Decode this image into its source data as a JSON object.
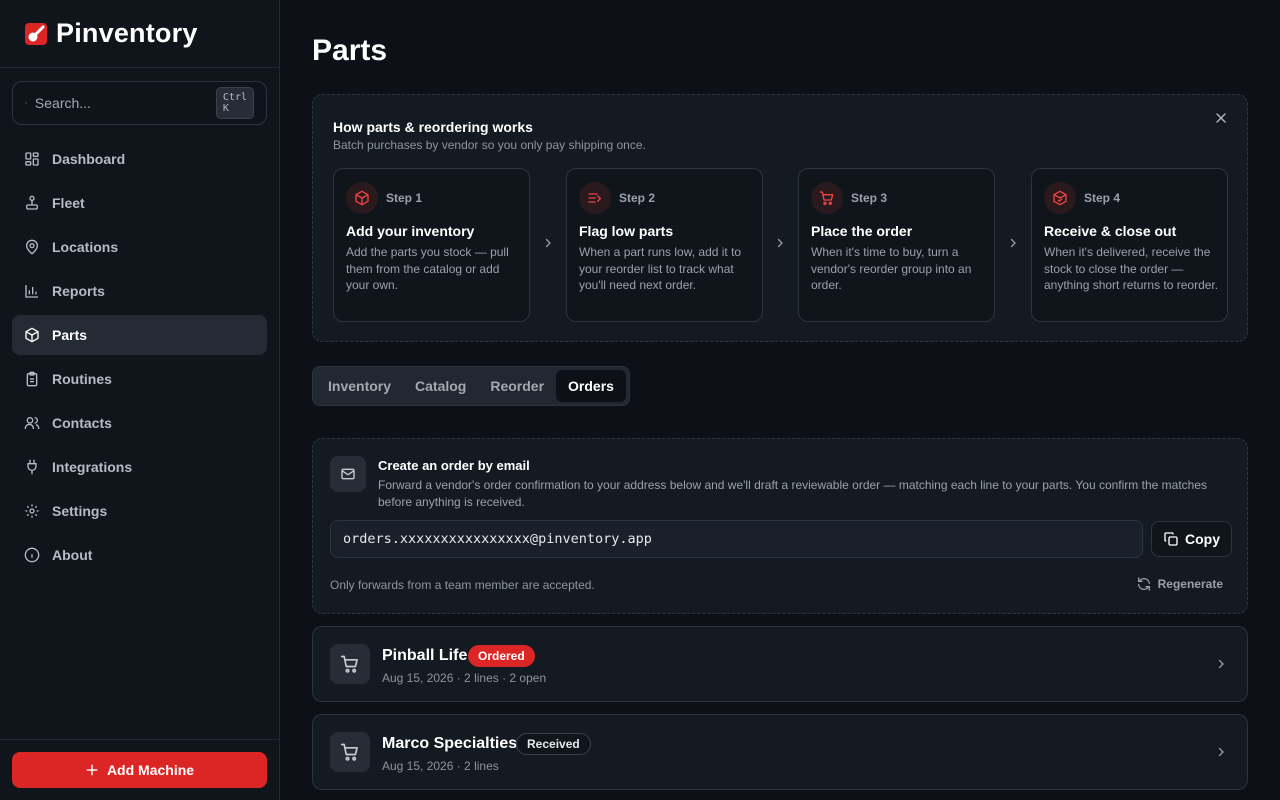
{
  "app": {
    "name": "Pinventory"
  },
  "search": {
    "placeholder": "Search...",
    "shortcut": "Ctrl K"
  },
  "sidebar": {
    "items": [
      {
        "label": "Dashboard",
        "icon": "dashboard-icon"
      },
      {
        "label": "Fleet",
        "icon": "joystick-icon"
      },
      {
        "label": "Locations",
        "icon": "map-pin-icon"
      },
      {
        "label": "Reports",
        "icon": "bar-chart-icon"
      },
      {
        "label": "Parts",
        "icon": "package-icon",
        "active": true
      },
      {
        "label": "Routines",
        "icon": "clipboard-icon"
      },
      {
        "label": "Contacts",
        "icon": "users-icon"
      },
      {
        "label": "Integrations",
        "icon": "plug-icon"
      },
      {
        "label": "Settings",
        "icon": "gear-icon"
      },
      {
        "label": "About",
        "icon": "info-icon"
      }
    ],
    "add_button": "Add Machine"
  },
  "page": {
    "title": "Parts"
  },
  "howto": {
    "title": "How parts & reordering works",
    "subtitle": "Batch purchases by vendor so you only pay shipping once.",
    "steps": [
      {
        "num": "Step 1",
        "title": "Add your inventory",
        "desc": "Add the parts you stock — pull them from the catalog or add your own.",
        "icon": "package-icon"
      },
      {
        "num": "Step 2",
        "title": "Flag low parts",
        "desc": "When a part runs low, add it to your reorder list to track what you'll need next order.",
        "icon": "list-plus-icon"
      },
      {
        "num": "Step 3",
        "title": "Place the order",
        "desc": "When it's time to buy, turn a vendor's reorder group into an order.",
        "icon": "cart-icon"
      },
      {
        "num": "Step 4",
        "title": "Receive & close out",
        "desc": "When it's delivered, receive the stock to close the order — anything short returns to reorder.",
        "icon": "package-check-icon"
      }
    ]
  },
  "tabs": [
    {
      "label": "Inventory"
    },
    {
      "label": "Catalog"
    },
    {
      "label": "Reorder"
    },
    {
      "label": "Orders",
      "active": true
    }
  ],
  "email_order": {
    "title": "Create an order by email",
    "description": "Forward a vendor's order confirmation to your address below and we'll draft a reviewable order — matching each line to your parts. You confirm the matches before anything is received.",
    "address": "orders.xxxxxxxxxxxxxxxx@pinventory.app",
    "copy_label": "Copy",
    "note": "Only forwards from a team member are accepted.",
    "regenerate_label": "Regenerate"
  },
  "orders": [
    {
      "vendor": "Pinball Life",
      "status": "Ordered",
      "meta": "Aug 15, 2026 · 2 lines · 2 open"
    },
    {
      "vendor": "Marco Specialties",
      "status": "Received",
      "meta": "Aug 15, 2026 · 2 lines"
    }
  ],
  "colors": {
    "accent": "#dc2626",
    "background": "#0d1117",
    "sidebar": "#10151c"
  }
}
